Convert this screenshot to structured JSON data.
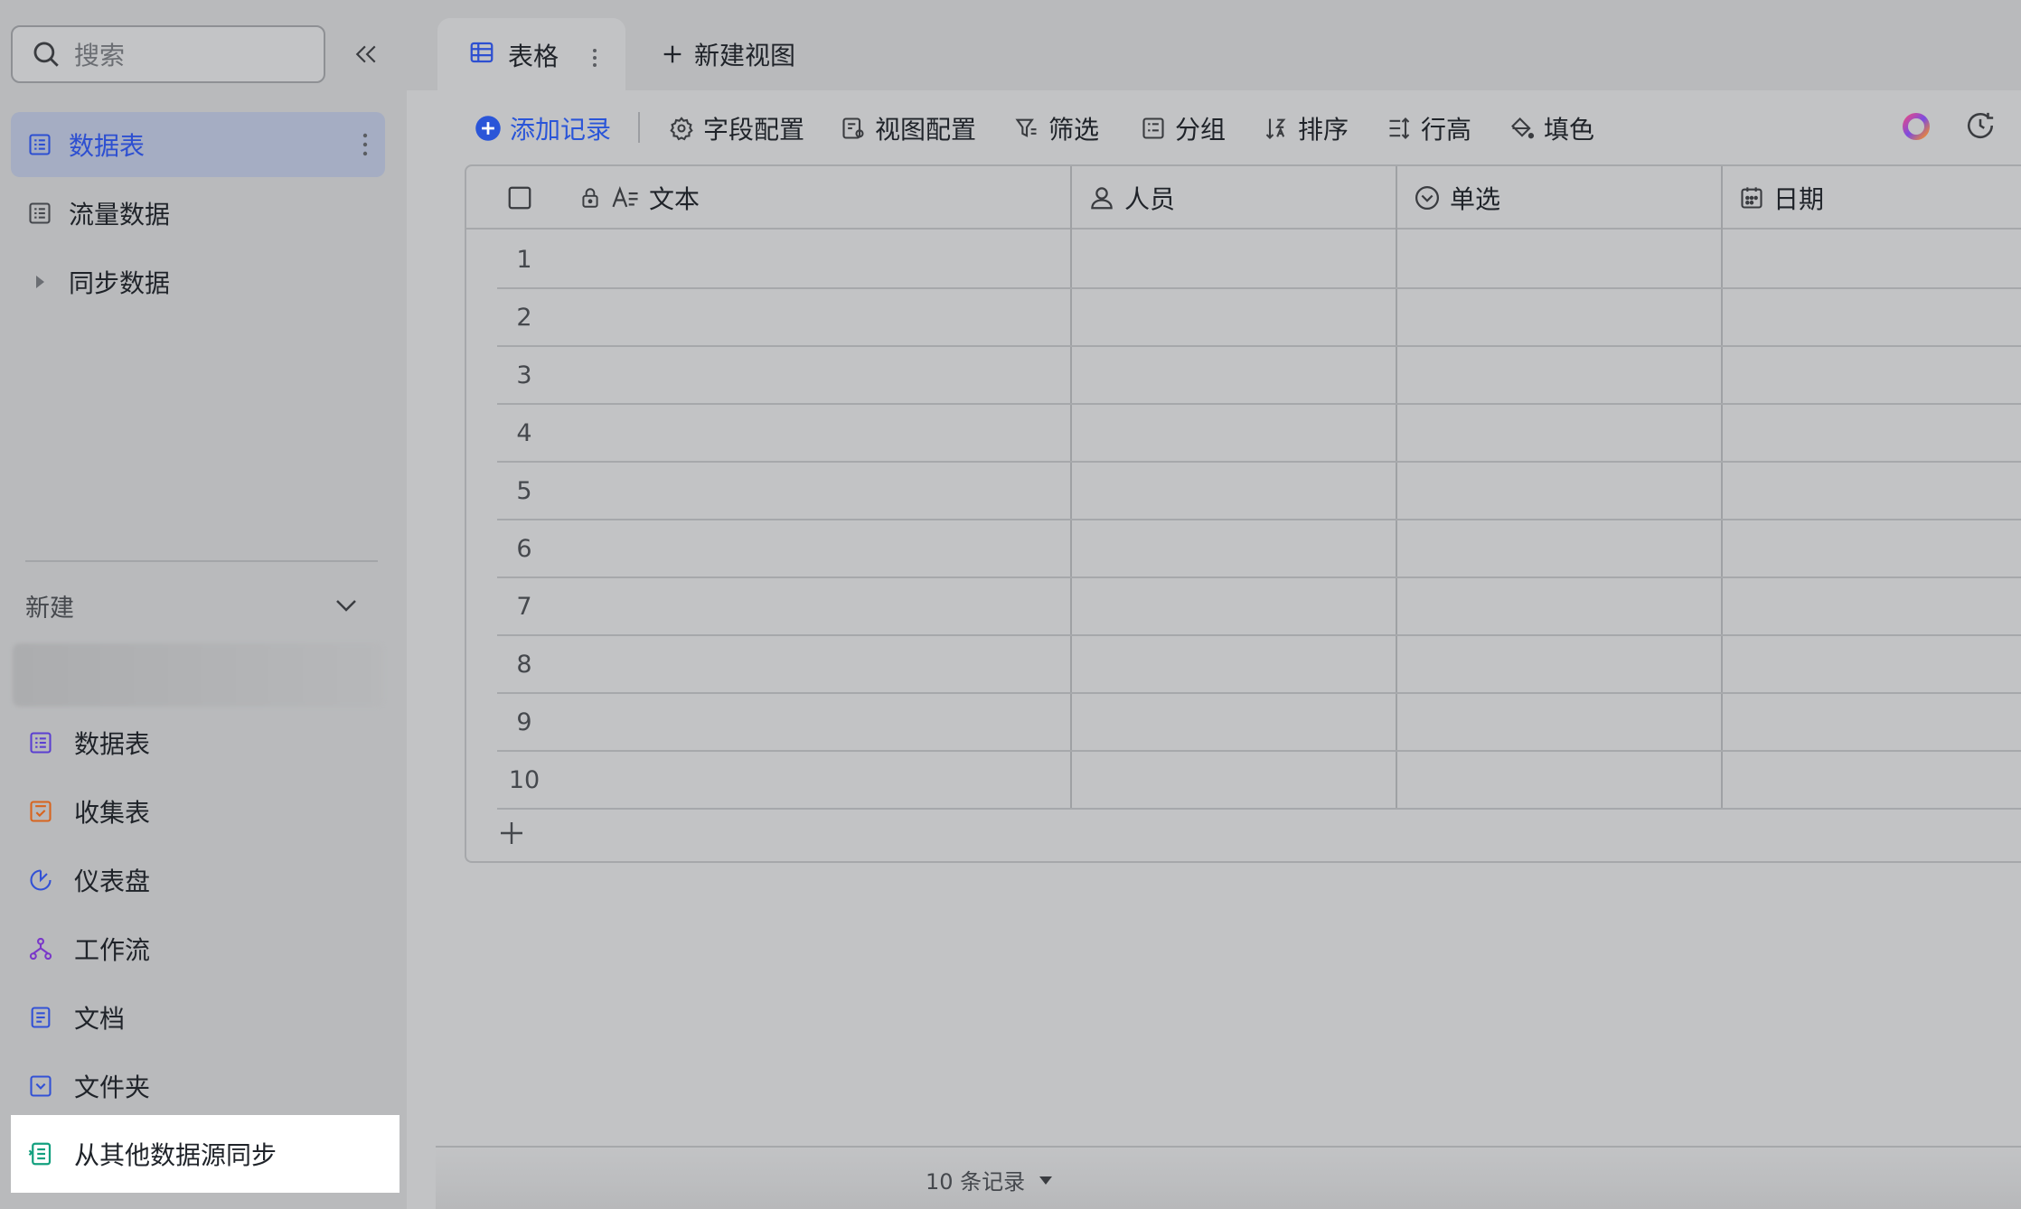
{
  "sidebar": {
    "search_placeholder": "搜索",
    "tables": [
      {
        "label": "数据表",
        "icon": "table-icon",
        "active": true
      },
      {
        "label": "流量数据",
        "icon": "table-icon",
        "active": false
      },
      {
        "label": "同步数据",
        "icon": "caret-right-icon",
        "active": false
      }
    ],
    "new_section_label": "新建",
    "create_items": [
      {
        "label": "数据表",
        "icon": "table-icon",
        "color": "#5b3fd1"
      },
      {
        "label": "收集表",
        "icon": "form-icon",
        "color": "#d8641e"
      },
      {
        "label": "仪表盘",
        "icon": "dashboard-icon",
        "color": "#3251d6"
      },
      {
        "label": "工作流",
        "icon": "workflow-icon",
        "color": "#7a38c9"
      },
      {
        "label": "文档",
        "icon": "document-icon",
        "color": "#3251d6"
      },
      {
        "label": "文件夹",
        "icon": "folder-icon",
        "color": "#3251d6"
      }
    ],
    "sync_item": {
      "label": "从其他数据源同步",
      "icon": "sync-source-icon",
      "color": "#13a07f"
    }
  },
  "tabs": {
    "active_tab": "表格",
    "new_view": "新建视图"
  },
  "toolbar": {
    "add_record": "添加记录",
    "field_config": "字段配置",
    "view_config": "视图配置",
    "filter": "筛选",
    "group": "分组",
    "sort": "排序",
    "row_height": "行高",
    "fill_color": "填色"
  },
  "table": {
    "columns": [
      {
        "label": "文本",
        "icon": "text-field-icon"
      },
      {
        "label": "人员",
        "icon": "person-icon"
      },
      {
        "label": "单选",
        "icon": "single-select-icon"
      },
      {
        "label": "日期",
        "icon": "calendar-icon"
      }
    ],
    "rows": [
      "1",
      "2",
      "3",
      "4",
      "5",
      "6",
      "7",
      "8",
      "9",
      "10"
    ]
  },
  "footer": {
    "record_count": "10 条记录"
  },
  "colors": {
    "accent": "#2a55d8",
    "active_bg": "#a5adc3"
  }
}
